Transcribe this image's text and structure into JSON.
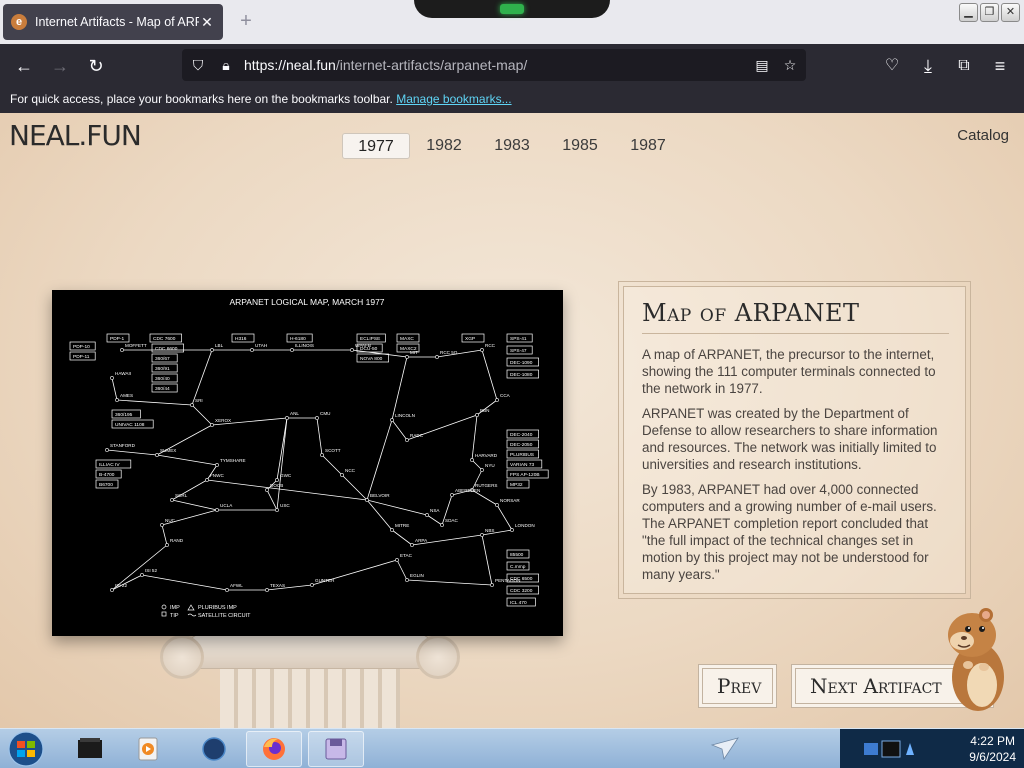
{
  "browser": {
    "tab_title": "Internet Artifacts - Map of ARPANET",
    "url_host": "https://neal.fun",
    "url_path": "/internet-artifacts/arpanet-map/",
    "bookmarks_prompt": "For quick access, place your bookmarks here on the bookmarks toolbar.",
    "bookmarks_link": "Manage bookmarks..."
  },
  "site": {
    "logo": "NEAL.FUN",
    "catalog": "Catalog",
    "years": [
      "1977",
      "1982",
      "1983",
      "1985",
      "1987"
    ],
    "selected_year": "1977"
  },
  "map": {
    "title": "ARPANET LOGICAL MAP, MARCH 1977",
    "legend": [
      "IMP",
      "PLURIBUS IMP",
      "TIP",
      "SATELLITE CIRCUIT"
    ],
    "sites": [
      "HAWAII",
      "MOFFETT",
      "LBL",
      "UTAH",
      "ILLINOIS",
      "WPAFB",
      "MIT",
      "RCC",
      "RCC 5O",
      "CCA",
      "AMES",
      "SRI",
      "XEROX",
      "STANFORD",
      "SUMEX",
      "TYMSHARE",
      "FNWC",
      "SCRL",
      "UCLA",
      "USC",
      "ANL",
      "CMU",
      "SCOTT",
      "NCC",
      "BELVOIR",
      "LINCOLN",
      "RADC",
      "BBN",
      "HARVARD",
      "NYU",
      "RUTGERS",
      "ABERDEEN",
      "NORSAR",
      "LONDON",
      "NBS",
      "ARPA",
      "MITRE",
      "NSA",
      "SDAC",
      "ETAC",
      "EGLIN",
      "PENTAGON",
      "GUNTER",
      "TEXAS",
      "AFWL",
      "ISI 22",
      "ISI 52",
      "NUC",
      "RAND",
      "DOCB",
      "GWC"
    ],
    "hosts": [
      "PDP-10",
      "PDP-11",
      "PDP-1",
      "CDC 7600",
      "CDC 6600",
      "360/67",
      "360/91",
      "360/40",
      "360/44",
      "360/195",
      "UNIVAC 1108",
      "ILLIAC IV",
      "B-4700",
      "B6700",
      "H316",
      "H-6180",
      "ECLIPSE",
      "DCU-50",
      "NOVA 800",
      "MAXC",
      "MAXC2",
      "XGP",
      "SPS-41",
      "SPS-47",
      "DEC-1090",
      "DEC-1080",
      "DEC-2040",
      "DEC-2050",
      "PLURIBUS",
      "VARIAN 73",
      "FPS AP-120B",
      "MP32",
      "85500",
      "C.mmp",
      "CDC 6500",
      "CDC 3200",
      "ICL 470"
    ]
  },
  "article": {
    "title": "Map of ARPANET",
    "paragraphs": [
      "A map of ARPANET, the precursor to the internet, showing the 111 computer terminals connected to the network in 1977.",
      "ARPANET was created by the Department of Defense to allow researchers to share information and resources. The network was initially limited to universities and research institutions.",
      "By 1983, ARPANET had over 4,000 connected computers and a growing number of e-mail users. The ARPANET completion report concluded that \"the full impact of the technical changes set in motion by this project may not be understood for many years.\""
    ]
  },
  "navigation": {
    "prev": "Prev",
    "next": "Next Artifact"
  },
  "taskbar": {
    "time": "4:22 PM",
    "date": "9/6/2024"
  }
}
